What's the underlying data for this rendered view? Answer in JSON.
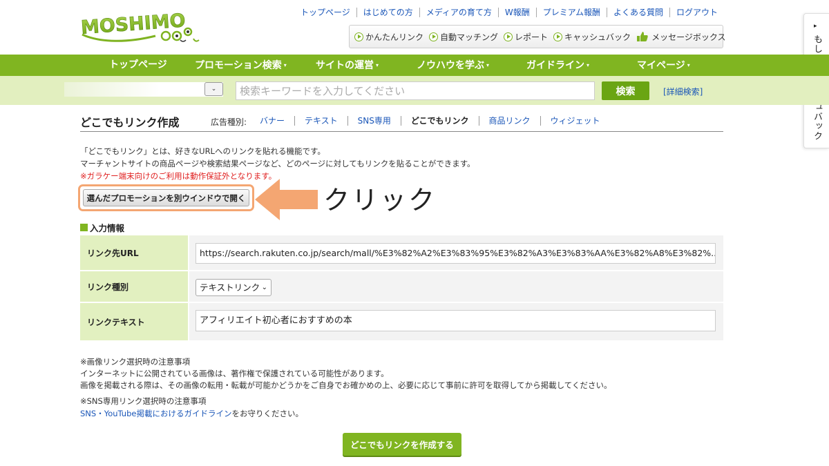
{
  "header": {
    "logo_text": "MOSHIMO",
    "top_links": [
      "トップページ",
      "はじめての方",
      "メディアの育て方",
      "W報酬",
      "プレミアム報酬",
      "よくある質問",
      "ログアウト"
    ],
    "quick_links": [
      "かんたんリンク",
      "自動マッチング",
      "レポート",
      "キャッシュバック"
    ],
    "message_box_label": "メッセージボックス"
  },
  "side_tab": {
    "arrow": "▸",
    "label": "もしもキャッシュバック"
  },
  "nav": {
    "items": [
      {
        "label": "トップページ",
        "caret": ""
      },
      {
        "label": "プロモーション検索",
        "caret": "▾"
      },
      {
        "label": "サイトの運営",
        "caret": "▾"
      },
      {
        "label": "ノウハウを学ぶ",
        "caret": "▾"
      },
      {
        "label": "ガイドライン",
        "caret": "▾"
      },
      {
        "label": "マイページ",
        "caret": "▾"
      }
    ]
  },
  "search": {
    "dropdown_arrow": "⌄",
    "placeholder": "検索キーワードを入力してください",
    "button_label": "検索",
    "advanced_label": "[詳細検索]"
  },
  "page": {
    "title": "どこでもリンク作成",
    "ad_type_label": "広告種別:",
    "ad_tabs": [
      "バナー",
      "テキスト",
      "SNS専用",
      "どこでもリンク",
      "商品リンク",
      "ウィジェット"
    ],
    "active_tab_index": 3,
    "description_1": "「どこでもリンク」とは、好きなURLへのリンクを貼れる機能です。",
    "description_2": "マーチャントサイトの商品ページや検索結果ページなど、どのページに対してもリンクを貼ることができます。",
    "warning": "※ガラケー端末向けのご利用は動作保証外となります。",
    "open_window_button": "選んだプロモーションを別ウインドウで開く",
    "click_label": "クリック"
  },
  "form": {
    "heading": "入力情報",
    "rows": [
      {
        "label": "リンク先URL",
        "value": "https://search.rakuten.co.jp/search/mall/%E3%82%A2%E3%83%95%E3%82%A3%E3%83%AA%E3%82%A8%E3%82%..."
      },
      {
        "label": "リンク種別",
        "value": "テキストリンク",
        "chevron": "⌄"
      },
      {
        "label": "リンクテキスト",
        "value": "アフィリエイト初心者におすすめの本"
      }
    ]
  },
  "notes": {
    "image_title": "※画像リンク選択時の注意事項",
    "image_line_1": "インターネットに公開されている画像は、著作権で保護されている可能性があります。",
    "image_line_2": "画像を掲載される際は、その画像の転用・転載が可能かどうかをご自身でお確かめの上、必要に応じて事前に許可を取得してから掲載してください。",
    "sns_title": "※SNS専用リンク選択時の注意事項",
    "sns_link": "SNS・YouTube掲載におけるガイドライン",
    "sns_suffix": "をお守りください。"
  },
  "create_button": "どこでもリンクを作成する",
  "colors": {
    "brand_green": "#80b521",
    "light_green": "#e2efbf",
    "link_blue": "#1a56b8",
    "highlight_orange": "#f4a672",
    "warning_red": "#e02020"
  }
}
